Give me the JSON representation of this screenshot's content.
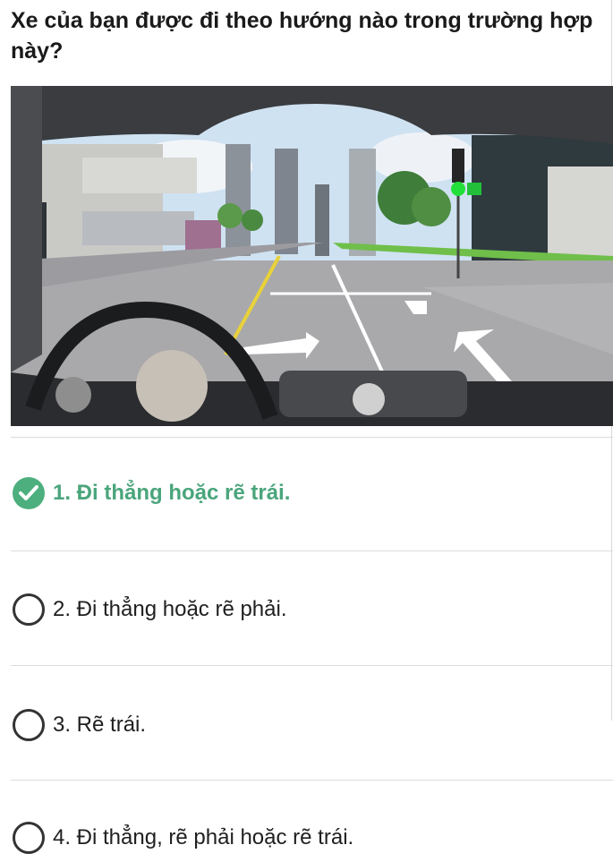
{
  "question": {
    "text": "Xe của bạn được đi theo hướng nào trong trường hợp này?"
  },
  "scene": {
    "icons": [
      "steering-wheel",
      "traffic-light-green",
      "lane-arrow-left-straight",
      "lane-arrow-straight",
      "lane-arrow-left"
    ],
    "colors": {
      "sky": "#cfe2f2",
      "road": "#a9a9ab",
      "grass": "#6fbf4a",
      "light_green": "#22e03a"
    }
  },
  "options": [
    {
      "label": "1. Đi thẳng hoặc rẽ trái.",
      "selected": true
    },
    {
      "label": "2. Đi thẳng hoặc rẽ phải.",
      "selected": false
    },
    {
      "label": "3. Rẽ trái.",
      "selected": false
    },
    {
      "label": "4. Đi thẳng, rẽ phải hoặc rẽ trái.",
      "selected": false
    }
  ],
  "colors": {
    "correct": "#4aa57c",
    "check_fill": "#4caf7d",
    "divider": "#dcdcdc"
  }
}
